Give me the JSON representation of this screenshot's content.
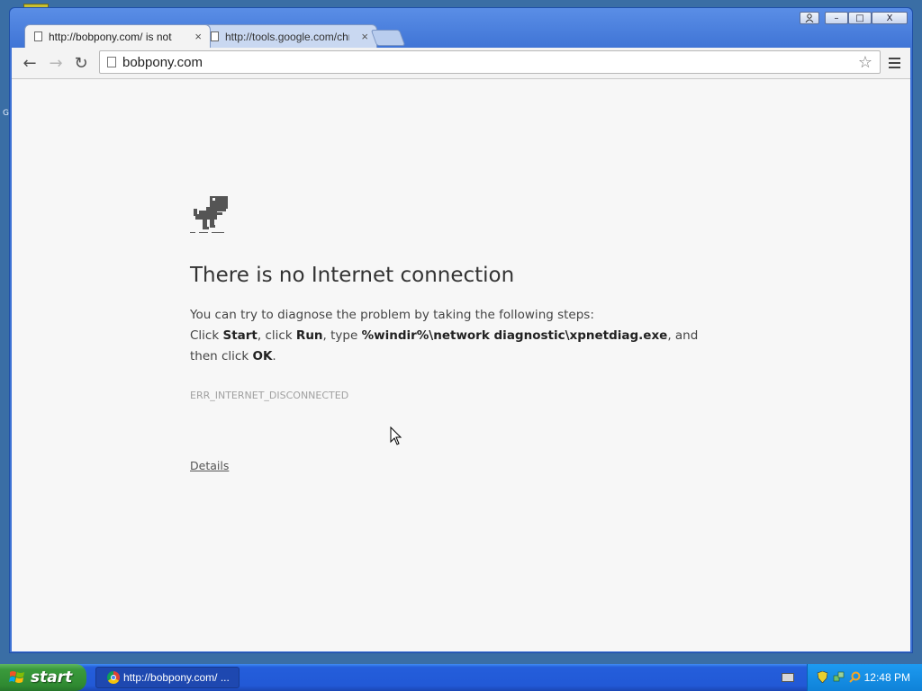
{
  "desktop": {
    "side_label": "G"
  },
  "window": {
    "controls": {
      "user_icon": "user-icon",
      "minimize": "–",
      "maximize": "□",
      "close": "X"
    }
  },
  "tabs": [
    {
      "title": "http://bobpony.com/ is not a",
      "close": "×",
      "active": true
    },
    {
      "title": "http://tools.google.com/chrome",
      "close": "×",
      "active": false
    }
  ],
  "toolbar": {
    "url": "bobpony.com",
    "back_icon": "←",
    "forward_icon": "→",
    "reload_icon": "↻",
    "star_icon": "☆"
  },
  "page": {
    "title": "There is no Internet connection",
    "intro": "You can try to diagnose the problem by taking the following steps:",
    "step_click": "Click ",
    "step_start": "Start",
    "step_sep1": ", click ",
    "step_run": "Run",
    "step_sep2": ", type ",
    "step_path": "%windir%\\network diagnostic\\xpnetdiag.exe",
    "step_sep3": ", and then click ",
    "step_ok": "OK",
    "step_end": ".",
    "error_code": "ERR_INTERNET_DISCONNECTED",
    "details_link": "Details"
  },
  "taskbar": {
    "start_label": "start",
    "task_item": "http://bobpony.com/ ...",
    "clock": "12:48 PM"
  },
  "colors": {
    "taskbar_blue": "#245edb",
    "start_green": "#3a9a3c",
    "window_blue": "#3d72d4",
    "page_bg": "#f7f7f7"
  }
}
